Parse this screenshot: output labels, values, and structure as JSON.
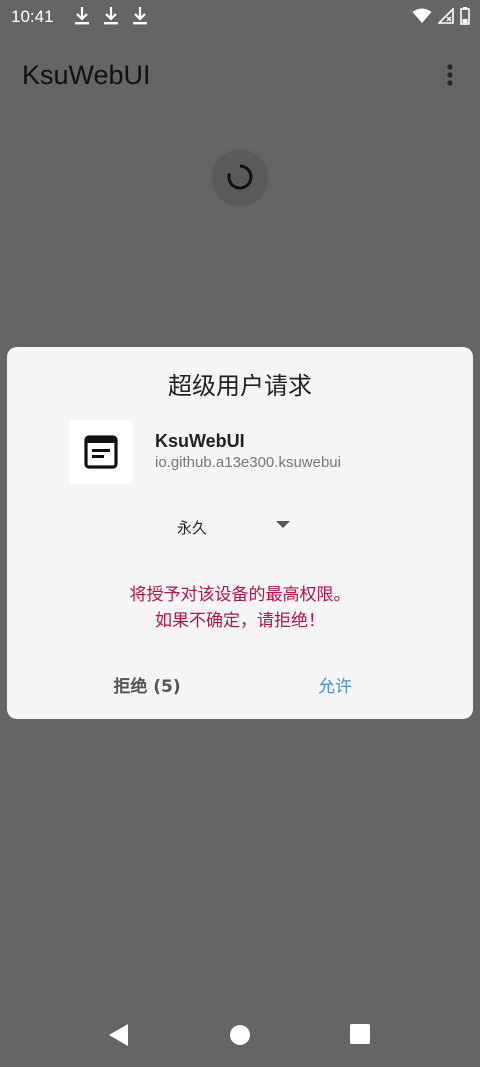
{
  "status_bar": {
    "time": "10:41",
    "left_icons": [
      "download-icon",
      "download-icon",
      "download-icon"
    ],
    "right_icons": [
      "wifi-icon",
      "signal-icon",
      "battery-icon"
    ]
  },
  "app_bar": {
    "title": "KsuWebUI",
    "menu_icon": "more-vert-icon"
  },
  "dialog": {
    "title": "超级用户请求",
    "app_name": "KsuWebUI",
    "app_package": "io.github.a13e300.ksuwebui",
    "app_icon": "web-window-icon",
    "duration_select": {
      "value": "永久"
    },
    "warning_line1": "将授予对该设备的最高权限。",
    "warning_line2": "如果不确定，请拒绝！",
    "deny_label": "拒绝 (5)",
    "allow_label": "允许"
  },
  "colors": {
    "background": "#656467",
    "dialog_bg": "#f5f5f5",
    "warning": "#b5134f",
    "accent": "#3a9bd8"
  }
}
